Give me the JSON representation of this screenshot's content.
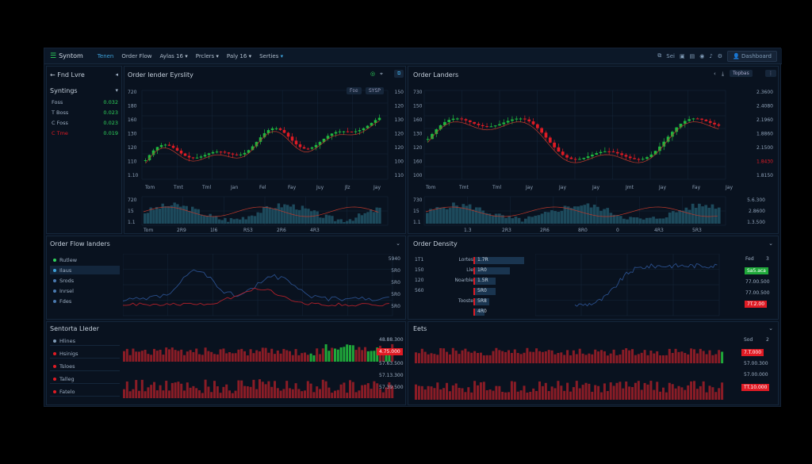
{
  "topbar": {
    "brand": "Syntom",
    "nav": [
      "Tenen",
      "Order Flow",
      "Aylas 16",
      "Prclers",
      "Paly 16",
      "Serties"
    ],
    "icons": [
      "filter-icon",
      "settings-icon",
      "doc-icon",
      "circle-icon",
      "mic-icon",
      "gear-icon",
      "user-icon"
    ],
    "filter_label": "Sei",
    "dashboard": "Dashboard"
  },
  "left_sidebar": {
    "title": "Fnd Lvre",
    "section": "Syntings",
    "rows": [
      {
        "label": "Foss",
        "value": "0.032"
      },
      {
        "label": "T Boss",
        "value": "0.023"
      },
      {
        "label": "C Foss",
        "value": "0.023"
      },
      {
        "label": "C Tme",
        "value": "0.019"
      }
    ]
  },
  "chart1": {
    "title": "Order lender Eyrslity",
    "buttons": [
      "Fee",
      "SYSP"
    ],
    "y_left": [
      "720",
      "180",
      "160",
      "130",
      "120",
      "110",
      "1.10"
    ],
    "y_right": [
      "150",
      "120",
      "130",
      "120",
      "120",
      "100",
      "110"
    ],
    "x_labels": [
      "Tom",
      "Tmt",
      "Tml",
      "Jan",
      "Fel",
      "Fay",
      "Juy",
      "Jlz",
      "Jay"
    ],
    "vol_left": [
      "720",
      "15",
      "1.1"
    ],
    "vol_x": [
      "Tom",
      "2R9",
      "1l6",
      "RS3",
      "2R6",
      "4R3"
    ],
    "colors": {
      "up": "#1fb83f",
      "down": "#e01b24",
      "ma": "#c0392b"
    }
  },
  "chart2": {
    "title": "Order Landers",
    "btn": "Topbas",
    "y_left": [
      "730",
      "150",
      "160",
      "130",
      "120",
      "160",
      "100"
    ],
    "y_right": [
      "2.3600",
      "2.4080",
      "2.1960",
      "1.8860",
      "2.1500",
      "1.8430",
      "1.8150"
    ],
    "x_labels": [
      "Tom",
      "Tmt",
      "Tml",
      "Jay",
      "Jay",
      "Jay",
      "Jmt",
      "Jay",
      "Fay",
      "Jay"
    ],
    "vol_left": [
      "730",
      "15",
      "1.1"
    ],
    "vol_right": [
      "5.6.300",
      "2.8600",
      "1.3.500"
    ],
    "vol_x": [
      "1.3",
      "2R3",
      "2R6",
      "8R0",
      "0",
      "4R3",
      "5R3"
    ]
  },
  "orderflow": {
    "title": "Order Flow landers",
    "rows": [
      {
        "label": "Rutlew",
        "color": "#2ed15a"
      },
      {
        "label": "Ilaus",
        "color": "#3da0d8"
      },
      {
        "label": "Srods",
        "color": "#4a7ab0"
      },
      {
        "label": "Inrsel",
        "color": "#4a7ab0"
      },
      {
        "label": "Fdes",
        "color": "#4a7ab0"
      }
    ],
    "y_right": [
      "5940",
      "5R0",
      "5R0",
      "5R0",
      "5R0"
    ]
  },
  "density": {
    "title": "Order Density",
    "y_left": [
      "1T1",
      "150",
      "120",
      "560"
    ],
    "book": [
      {
        "label": "Lortes",
        "value": "1.7R"
      },
      {
        "label": "Lle",
        "value": "1R0"
      },
      {
        "label": "Noarble",
        "value": "1.5R"
      },
      {
        "label": "",
        "value": "5R0"
      },
      {
        "label": "Tooste",
        "value": "5R8"
      },
      {
        "label": "",
        "value": "4R0"
      }
    ],
    "right": {
      "top": "Fed",
      "num": "3",
      "tags": [
        "Sa5.aca",
        "77.00.500",
        "77.00.500",
        "7T.2.00"
      ]
    }
  },
  "sentiment": {
    "title": "Sentorta Lleder",
    "rows": [
      {
        "label": "Hlines",
        "color": "#7f9ab5"
      },
      {
        "label": "Hsinigs",
        "color": "#e01b24"
      },
      {
        "label": "Tsloes",
        "color": "#e01b24"
      },
      {
        "label": "Talleg",
        "color": "#e01b24"
      },
      {
        "label": "Fatelo",
        "color": "#e01b24"
      }
    ],
    "values": [
      "48.88.300",
      "4.75.000",
      "57.63.500",
      "57.13.300",
      "57.39.500"
    ]
  },
  "bets": {
    "title": "Eets",
    "right": {
      "top": "Sod",
      "num": "2"
    },
    "values": [
      "7.T.000",
      "57.00.300",
      "57.00.000",
      "TT.10.000"
    ]
  }
}
